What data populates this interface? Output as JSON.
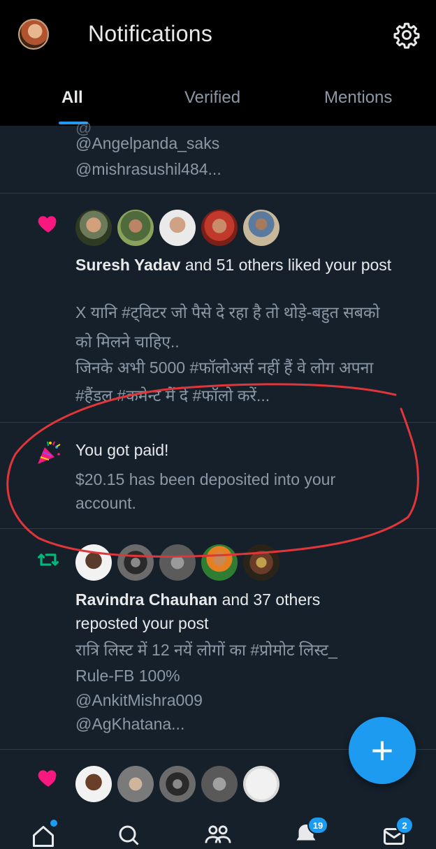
{
  "header": {
    "title": "Notifications"
  },
  "tabs": [
    {
      "label": "All"
    },
    {
      "label": "Verified"
    },
    {
      "label": "Mentions"
    }
  ],
  "notifications": {
    "top": {
      "lines": [
        "@Angelpanda_saks",
        "@mishrasushil484..."
      ]
    },
    "like": {
      "actor": "Suresh Yadav",
      "action": "and 51 others liked your post",
      "post_lines": [
        "X यानि #ट्विटर जो पैसे दे रहा है तो थोड़े-बहुत सबको",
        "को मिलने चाहिए..",
        "जिनके अभी 5000 #फॉलोअर्स नहीं हैं वे लोग अपना",
        "#हैंडल #कमेन्ट में दें #फॉलो करें..."
      ]
    },
    "paid": {
      "title": "You got paid!",
      "line1": "$20.15 has been deposited into your",
      "line2": "account."
    },
    "repost": {
      "actor": "Ravindra Chauhan",
      "action": "and 37 others",
      "action2": "reposted your post",
      "post_lines": [
        "रात्रि लिस्ट में 12 नयें लोगों का #प्रोमोट लिस्ट_",
        "Rule-FB 100%",
        "@AnkitMishra009",
        "@AgKhatana..."
      ]
    }
  },
  "fab": {
    "symbol": "+"
  },
  "bottom_nav": {
    "items": [
      {
        "icon": "home-icon"
      },
      {
        "icon": "search-icon"
      },
      {
        "icon": "communities-icon"
      },
      {
        "icon": "notifications-bell-icon",
        "badge": "19"
      },
      {
        "icon": "messages-icon",
        "badge": "2"
      }
    ]
  },
  "colors": {
    "accent": "#1d9bf0",
    "heart": "#f91880",
    "retweet": "#00ba7c",
    "annotation": "#e0363a",
    "background": "#15202b"
  }
}
